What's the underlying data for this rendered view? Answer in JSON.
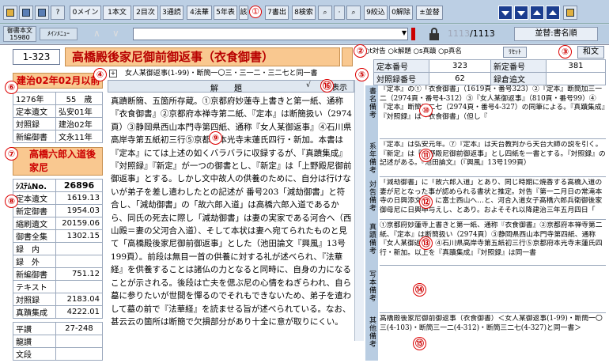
{
  "toolbar": {
    "buttons": [
      {
        "label": "",
        "kind": "folder-open-icon"
      },
      {
        "label": "",
        "kind": "export-icon"
      },
      {
        "label": "",
        "kind": "print-icon"
      },
      {
        "label": "",
        "kind": "help-icon"
      },
      {
        "label": "0メイン"
      },
      {
        "label": "1本文"
      },
      {
        "label": "2目次"
      },
      {
        "label": "3通読"
      },
      {
        "label": "4法華"
      },
      {
        "label": "5年表"
      },
      {
        "label": "①",
        "kind": "callout"
      },
      {
        "label": "7書出"
      },
      {
        "label": "8検索"
      },
      {
        "label": "",
        "kind": "search-icon"
      },
      {
        "label": "",
        "kind": "dot-icon"
      },
      {
        "label": "",
        "kind": "search-range-icon"
      },
      {
        "label": "9絞込"
      },
      {
        "label": "0解除"
      },
      {
        "label": "±並替"
      }
    ],
    "mini_label": "該"
  },
  "row2": {
    "label_top": "御書本文",
    "label_bottom": "15980",
    "menu_label": "ﾒｲﾝﾒﾆｭｰ",
    "up_arrow": "∧",
    "down_arrow": "∨",
    "record_current": "1113",
    "record_total": "/1113",
    "sort_label": "並替:書名順"
  },
  "header": {
    "doc_number": "1-323",
    "doc_title": "高橋殿後家尼御前御返事（衣食御書）",
    "kanbun_button": "和文"
  },
  "radio_group": {
    "options": [
      "t対告",
      "k解題",
      "s真蹟",
      "p真名"
    ],
    "reset_label": "ﾘｾｯﾄ"
  },
  "numbers_table": {
    "rows": [
      {
        "label": "定本番号",
        "value": "323",
        "label2": "新定番号",
        "value2": "381"
      },
      {
        "label": "対照録番号",
        "value": "62",
        "label2": "録倉追文",
        "value2": ""
      }
    ]
  },
  "left_panel": {
    "date_heading": "建治02年02月以前",
    "year_rows": [
      {
        "label": "1276年",
        "value": "55　歳"
      },
      {
        "label": "定本遺文",
        "value": "弘安01年"
      },
      {
        "label": "対照録",
        "value": "建治02年"
      },
      {
        "label": "新編御書",
        "value": "文永11年"
      }
    ],
    "recipient_heading": "高橋六郎入道後家尼",
    "system_label": "ｼｽﾃﾑNo.",
    "system_value": "26896",
    "page_rows": [
      {
        "label": "定本遺文",
        "value": "1619.13"
      },
      {
        "label": "新定御書",
        "value": "1954.03"
      },
      {
        "label": "縮刷遺文",
        "value": "20159.06"
      },
      {
        "label": "御書全集",
        "value": "1302.15"
      },
      {
        "label": "録　内",
        "value": ""
      },
      {
        "label": "録　外",
        "value": ""
      },
      {
        "label": "新編御書",
        "value": "751.12"
      },
      {
        "label": "テキスト",
        "value": ""
      },
      {
        "label": "対照録",
        "value": "2183.04"
      },
      {
        "label": "真蹟集成",
        "value": "4222.01"
      }
    ],
    "bottom_rows": [
      {
        "label": "平讃",
        "value": "27-248"
      },
      {
        "label": "龍讃",
        "value": ""
      },
      {
        "label": "文段",
        "value": ""
      }
    ]
  },
  "center": {
    "related_line": "女人某御返事(1-99)・断簡一〇三・三一二・三二七と同一書",
    "tab_label": "解　　題",
    "show_label": "表示",
    "body": "真蹟断簡、五箇所存蔵。①京都府妙蓮寺上書きと第一紙、通称『衣食御書』②京都府本禅寺第二紙、『定本』は断簡扱い（2974頁）③静岡県西山本門寺第四紙、通称『女人某御返事』④石川県高岸寺第五紙初三行⑤京都府本光寺末蓮氏四行・新加。本書は『定本』にては上述の如くバラバラに収録するが、『真蹟集成』『対照録』『新定』が一つの御書とし、『新定』は「上野殿尼御前御返事」とする。しかし文中故人の供養のために、自分は行けないが弟子を差し遣わしたとの記述が 番号203「減劫御書」と符合し、「減劫御書」の「故六郎入道」は高橋六郎入道であるから、同氏の死去に際し「減劫御書」は妻の実家である河合へ（西山殿＝妻の父河合入道）、そして本状は妻へ宛てられたものと見て「高橋殿後家尼御前御返事」とした（池田論文『興風』13号199頁）。前段は無目一首の供養に対する礼が述べられ、『法華経』を供養することは諸仏の力となると同時に、自身の力になることが示される。後段は亡夫を偲ぶ尼の心情をねぎらわれ、自ら墓に参りたいが世間を憚るのでそれもできないため、弟子を遣わして墓の前で『法華経』を読ませる旨が述べられている。なお、甚云云の箇所は断簡で欠損部分があり十全に意が取りにくい。"
  },
  "right_sections": [
    {
      "tab": "書名備考",
      "text": "『定本』の①「衣食御書」（1619頁・番号323）②『定本』断簡加三一二（2974頁・番号4-312）③『女人某御返事』（810頁・番号99）④『定本』断簡三二七（2974頁・番号4-327）の同筆による。『真蹟集成』『対照録』は「衣食御書」（但し『"
    },
    {
      "tab": "系年備考",
      "text": "『定本』は弘安元年。⑦『定本』は天台教判から天台大師の説を引く。『新定』は「上野殿尼御前御返事」とし四紙を一書とする。『対照録』の記述がある。『池田論文』（『興風』13号199頁）"
    },
    {
      "tab": "対告備考",
      "text": "「減劫御書」に「故六郎入道」とあり、同じ時期に焼香する高橋入道の妻が尼となった事が認められる書状と推定。対告『第一二月日の常滝本寺の日興添文書』に富士西山へ…と、河合入道女子高橋六郎兵衛御後家御母尼に日興申与えし、とあり。およそそれ以降建治三年五月四日「"
    },
    {
      "tab": "真蹟備考",
      "text": "①京都府妙蓮寺上書きと第一紙、通称『衣食御書』②京都府本禅寺第二紙、『定本』は断簡扱い（2974頁）③静岡県西山本門寺第四紙、通称『女人某御返事』④石川県高岸寺第五紙初三行⑤京都府本光寺末蓮氏四行・新加。以上を『真蹟集成』『対照録』は同一書"
    },
    {
      "tab": "写本備考",
      "text": ""
    },
    {
      "tab": "其他備考",
      "text": "高橋殿後家尼御前御返事（衣食御書）＜女人某御返事(1-99)・断簡一〇三(4-103)・断簡三一二(4-312)・断簡三二七(4-327)と同一書＞"
    }
  ],
  "callouts": [
    "①",
    "②",
    "③",
    "④",
    "⑤",
    "⑥",
    "⑦",
    "⑧",
    "⑨",
    "⑩",
    "⑪",
    "⑫",
    "⑬",
    "⑭",
    "⑮",
    "⑯"
  ]
}
